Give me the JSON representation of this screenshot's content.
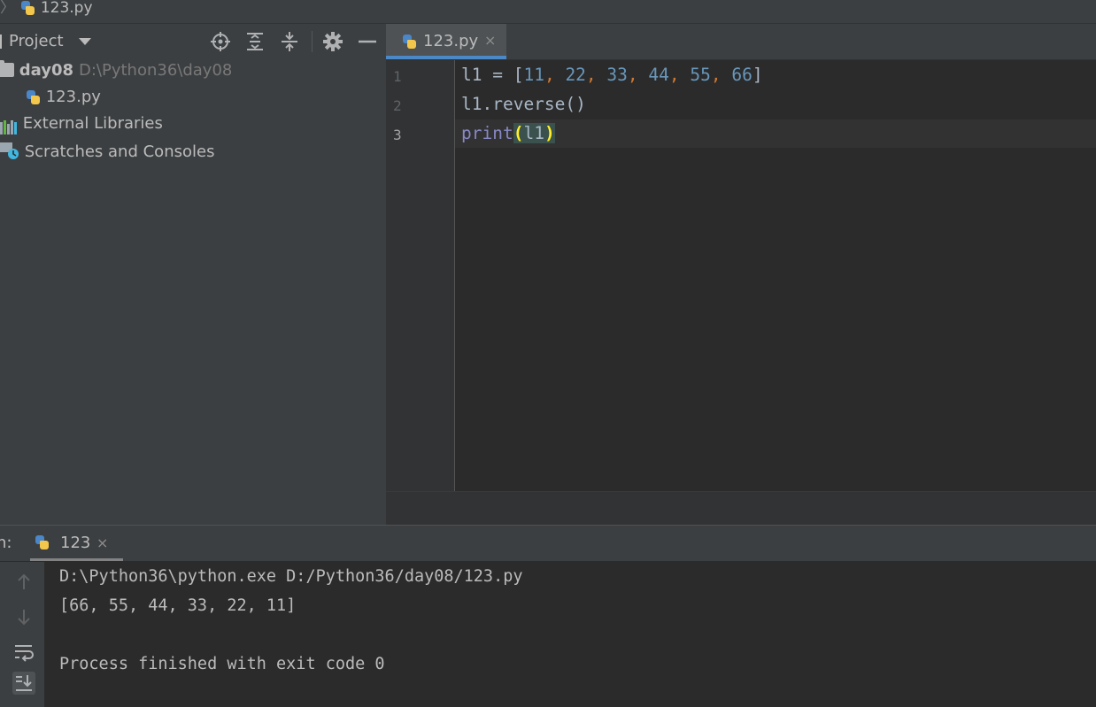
{
  "breadcrumb": {
    "file": "123.py"
  },
  "project_panel": {
    "title": "Project",
    "toolbar": [
      "locate-icon",
      "expand-all-icon",
      "collapse-all-icon",
      "gear-icon",
      "minimize-icon"
    ],
    "tree": [
      {
        "label": "day08",
        "path": "D:\\Python36\\day08",
        "icon": "folder-icon"
      },
      {
        "label": "123.py",
        "icon": "python-file-icon"
      },
      {
        "label": "External Libraries",
        "icon": "libraries-icon"
      },
      {
        "label": "Scratches and Consoles",
        "icon": "scratches-icon"
      }
    ]
  },
  "editor": {
    "tab": {
      "label": "123.py",
      "close": "×"
    },
    "line_numbers": [
      "1",
      "2",
      "3"
    ],
    "current_line": 3,
    "code": {
      "l1_var": "l1 = [",
      "n11": "11",
      "n22": "22",
      "n33": "33",
      "n44": "44",
      "n55": "55",
      "n66": "66",
      "comma": ",",
      "close_bracket": "]",
      "line2": "l1.reverse()",
      "line3_func": "print",
      "line3_open": "(",
      "line3_arg": "l1",
      "line3_close": ")"
    }
  },
  "run_panel": {
    "label": "n:",
    "tab": {
      "label": "123",
      "close": "×"
    },
    "output": [
      "D:\\Python36\\python.exe D:/Python36/day08/123.py",
      "[66, 55, 44, 33, 22, 11]",
      "",
      "Process finished with exit code 0"
    ],
    "side_tools": [
      "arrow-up-icon",
      "arrow-down-icon",
      "soft-wrap-icon",
      "scroll-to-end-icon"
    ]
  },
  "colors": {
    "accent": "#4a88c7",
    "number": "#6897bb",
    "keyword_comma": "#cc7832",
    "builtin": "#8888c6",
    "brace_highlight": "#ffef28"
  }
}
